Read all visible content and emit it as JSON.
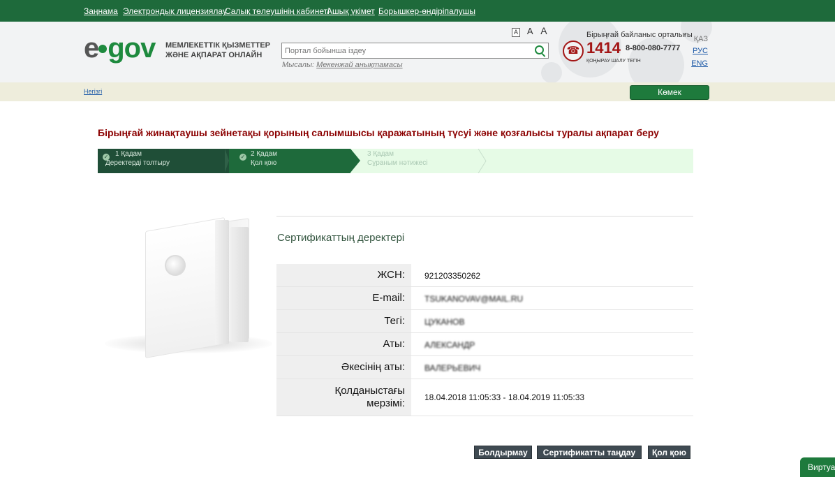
{
  "topnav": [
    "Заңнама",
    "Электрондық лицензиялау",
    "Салық төлеушінің кабинеті",
    "Ашық үкімет",
    "Борышкер-өндіріпалушы"
  ],
  "header": {
    "logo_e": "e",
    "logo_gov": "gov",
    "tagline_line1": "МЕМЛЕКЕТТІК ҚЫЗМЕТТЕР",
    "tagline_line2": "ЖӘНЕ АҚПАРАТ ОНЛАЙН",
    "font_sizes": [
      "A",
      "A",
      "A"
    ],
    "search_placeholder": "Портал бойынша іздеу",
    "example_label": "Мысалы:",
    "example_link": "Мекенжай анықтамасы",
    "contact_title": "Бірыңғай байланыс орталығы",
    "contact_number": "1414",
    "contact_alt": "8-800-080-7777",
    "contact_free": "ҚОҢЫРАУ ШАЛУ ТЕГІН",
    "languages": [
      "ҚАЗ",
      "РУС",
      "ENG"
    ]
  },
  "subbar": {
    "home_link": "Негізгі",
    "help_label": "Көмек"
  },
  "page_title": "Бірыңғай жинақтаушы зейнетақы қорының салымшысы қаражатының түсуі және қозғалысы туралы ақпарат беру",
  "steps": [
    {
      "num": "1 Қадам",
      "label": "Деректерді толтыру"
    },
    {
      "num": "2 Қадам",
      "label": "Қол қою"
    },
    {
      "num": "3 Қадам",
      "label": "Сұраным нәтижесі"
    }
  ],
  "certificate": {
    "title": "Сертификаттың деректері",
    "rows": [
      {
        "label": "ЖСН:",
        "value": "921203350262"
      },
      {
        "label": "E-mail:",
        "value": "TSUKANOVAV@MAIL.RU"
      },
      {
        "label": "Тегі:",
        "value": "ЦУКАНОВ"
      },
      {
        "label": "Аты:",
        "value": "АЛЕКСАНДР"
      },
      {
        "label": "Әкесінің аты:",
        "value": "ВАЛЕРЬЕВИЧ"
      },
      {
        "label_line1": "Қолданыстағы",
        "label_line2": "мерзімі:",
        "value": "18.04.2018 11:05:33 - 18.04.2019 11:05:33"
      }
    ]
  },
  "buttons": {
    "cancel": "Болдырмау",
    "choose_cert": "Сертификатты таңдау",
    "sign": "Қол қою"
  },
  "virtual_assistant": "Виртуа",
  "colors": {
    "topbar": "#1e6a3b",
    "title_red": "#8b0000",
    "step_dark": "#1f4e37",
    "step_active": "#1e6a3b",
    "button_gray": "#3f4a52",
    "help_green": "#1e7a3c"
  }
}
